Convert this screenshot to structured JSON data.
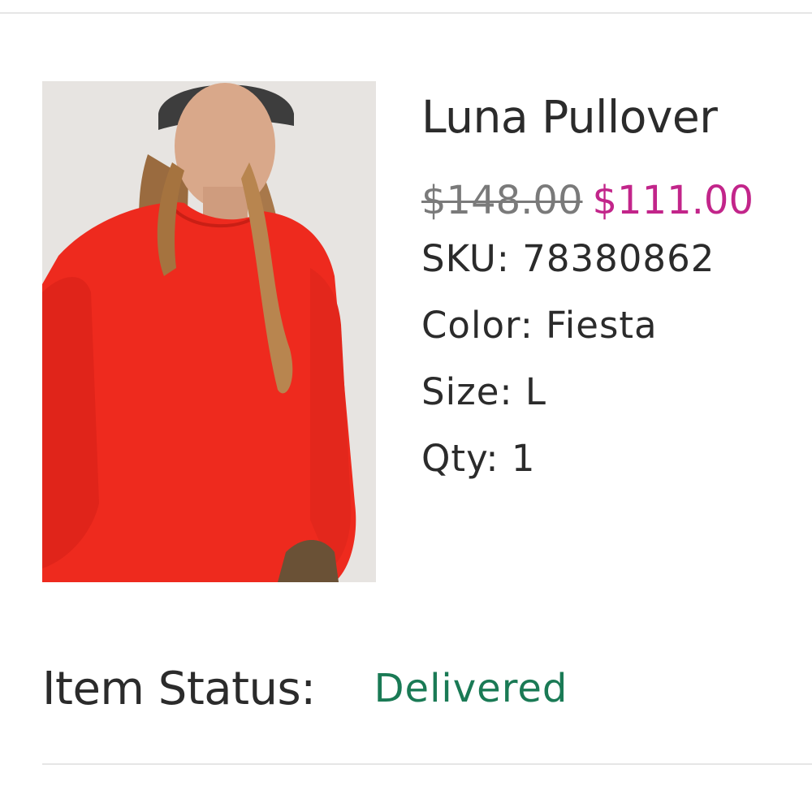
{
  "item": {
    "name": "Luna Pullover",
    "original_price": "$148.00",
    "sale_price": "$111.00",
    "sku_label": "SKU:",
    "sku": "78380862",
    "color_label": "Color:",
    "color": "Fiesta",
    "size_label": "Size:",
    "size": "L",
    "qty_label": "Qty:",
    "qty": "1"
  },
  "status": {
    "label": "Item Status:",
    "value": "Delivered"
  },
  "colors": {
    "sale_price": "#c2258a",
    "status_delivered": "#1a7a55",
    "original_price": "#7a7a7a",
    "text": "#2b2b2b"
  }
}
